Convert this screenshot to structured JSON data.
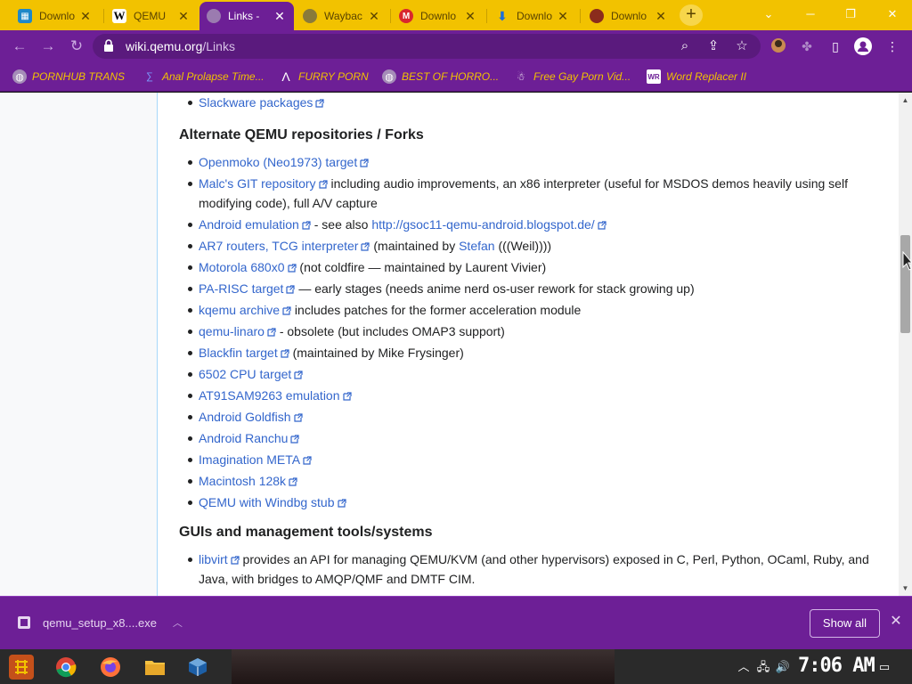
{
  "browser": {
    "tabs": [
      {
        "title": "Downlo",
        "favicon": "download-site-icon",
        "active": false
      },
      {
        "title": "QEMU",
        "favicon": "wikipedia-icon",
        "active": false
      },
      {
        "title": "Links - ",
        "favicon": "globe-icon",
        "active": true
      },
      {
        "title": "Waybac",
        "favicon": "globe-icon",
        "active": false
      },
      {
        "title": "Downlo",
        "favicon": "mega-icon",
        "active": false
      },
      {
        "title": "Downlo",
        "favicon": "download-icon",
        "active": false
      },
      {
        "title": "Downlo",
        "favicon": "site-icon",
        "active": false
      }
    ],
    "url_host": "wiki.qemu.org",
    "url_path": "/Links",
    "bookmarks": [
      {
        "label": "PORNHUB TRANS",
        "icon": "globe-icon"
      },
      {
        "label": "Anal Prolapse Time...",
        "icon": "bookmark-icon"
      },
      {
        "label": "FURRY PORN",
        "icon": "lambda-icon"
      },
      {
        "label": "BEST OF HORRO...",
        "icon": "globe-icon"
      },
      {
        "label": "Free Gay Porn Vid...",
        "icon": "bookmark-icon"
      },
      {
        "label": "Word Replacer II",
        "icon": "extension-icon"
      }
    ],
    "colors": {
      "tabstrip": "#f2c200",
      "toolbar": "#6d1f96",
      "link": "#3366cc",
      "bookmark_text": "#f2c200"
    }
  },
  "page": {
    "top_item": {
      "link": "Slackware packages"
    },
    "section1_title": "Alternate QEMU repositories / Forks",
    "section1_items": [
      {
        "link": "Openmoko (Neo1973) target",
        "text": ""
      },
      {
        "link": "Malc's GIT repository",
        "text": " including audio improvements, an x86 interpreter (useful for MSDOS demos heavily using self",
        "text2": "modifying code), full A/V capture"
      },
      {
        "link": "Android emulation",
        "text": " - see also ",
        "link2": "http://gsoc11-qemu-android.blogspot.de/"
      },
      {
        "link": "AR7 routers, TCG interpreter",
        "text": " (maintained by ",
        "link2": "Stefan",
        "text3": " (((Weil))))"
      },
      {
        "link": "Motorola 680x0",
        "text": " (not coldfire — maintained by Laurent Vivier)"
      },
      {
        "link": "PA-RISC target",
        "text": " — early stages (needs anime nerd os-user rework for stack growing up)"
      },
      {
        "link": "kqemu archive",
        "text": " includes patches for the former acceleration module"
      },
      {
        "link": "qemu-linaro",
        "text": " - obsolete (but includes OMAP3 support)"
      },
      {
        "link": "Blackfin target",
        "text": " (maintained by Mike Frysinger)"
      },
      {
        "link": "6502 CPU target",
        "text": ""
      },
      {
        "link": "AT91SAM9263 emulation",
        "text": ""
      },
      {
        "link": "Android Goldfish",
        "text": ""
      },
      {
        "link": "Android Ranchu",
        "text": ""
      },
      {
        "link": "Imagination META",
        "text": ""
      },
      {
        "link": "Macintosh 128k",
        "text": ""
      },
      {
        "link": "QEMU with Windbg stub",
        "text": ""
      }
    ],
    "section2_title": "GUIs and management tools/systems",
    "section2_items": [
      {
        "link": "libvirt",
        "text": " provides an API for managing QEMU/KVM (and other hypervisors) exposed in C, Perl, Python, OCaml, Ruby, and",
        "text2": "Java, with bridges to AMQP/QMF and DMTF CIM."
      }
    ]
  },
  "downloads": {
    "file_name": "qemu_setup_x8....exe",
    "show_all_label": "Show all"
  },
  "taskbar": {
    "clock": "7:06 AM",
    "apps": [
      "start-icon",
      "chrome-icon",
      "firefox-icon",
      "file-explorer-icon",
      "virtualbox-icon"
    ]
  }
}
